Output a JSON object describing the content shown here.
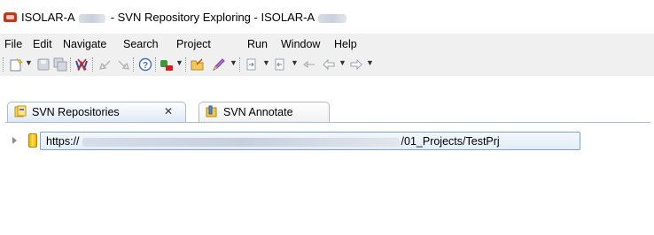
{
  "window": {
    "title_app": "ISOLAR-A",
    "title_middle": "- SVN Repository Exploring - ISOLAR-A"
  },
  "menu": [
    "File",
    "Edit",
    "Navigate",
    "Search",
    "Project",
    "Run",
    "Window",
    "Help"
  ],
  "toolbar": {
    "icons": [
      "new-wizard-icon",
      "save-icon",
      "save-all-icon",
      "web-wizard-icon",
      "back-history-icon",
      "forward-history-icon",
      "help-icon",
      "svn-checkout-icon",
      "open-folder-icon",
      "pen-icon",
      "next-annotation-icon",
      "prev-annotation-icon",
      "last-edit-icon",
      "back-icon",
      "forward-icon"
    ]
  },
  "tabs": [
    {
      "label": "SVN Repositories",
      "close": "✕",
      "active": true
    },
    {
      "label": "SVN Annotate",
      "active": false
    }
  ],
  "repository": {
    "url_prefix": "https://",
    "url_suffix": "/01_Projects/TestPrj"
  }
}
